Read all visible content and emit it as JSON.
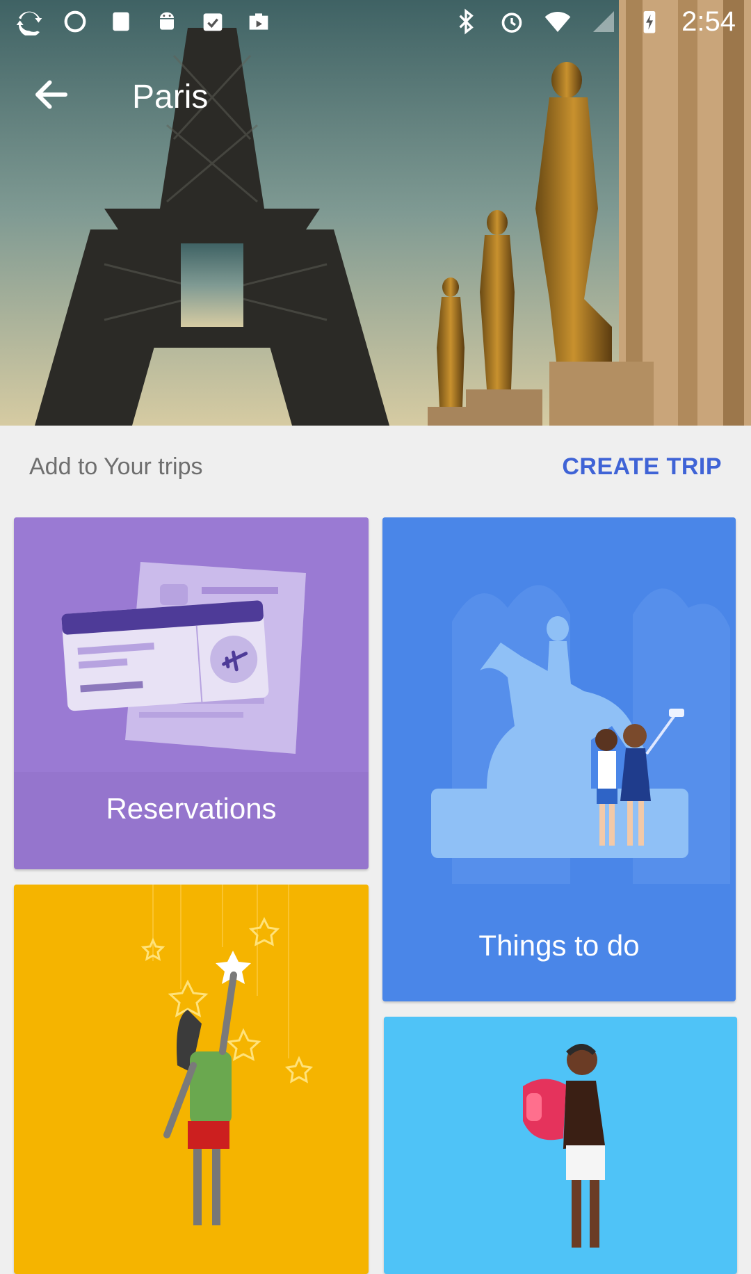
{
  "status_bar": {
    "time": "2:54",
    "left_icons": [
      "sync-icon",
      "circle-icon",
      "notification-icon",
      "android-icon",
      "assignment-icon",
      "work-icon"
    ],
    "right_icons": [
      "bluetooth-icon",
      "alarm-icon",
      "wifi-icon",
      "signal-icon",
      "battery-charging-icon"
    ]
  },
  "header": {
    "title": "Paris",
    "back_icon": "arrow-left-icon"
  },
  "section": {
    "label": "Add to Your trips",
    "action": "CREATE TRIP"
  },
  "cards": [
    {
      "label": "Reservations",
      "color": "#9575cd"
    },
    {
      "label": "Things to do",
      "color": "#4a86e8"
    },
    {
      "label": "",
      "color": "#f5b400"
    },
    {
      "label": "",
      "color": "#4fc3f7"
    }
  ],
  "colors": {
    "accent": "#3f63d6",
    "background": "#efefef",
    "secondary_text": "#6e6e6e"
  }
}
